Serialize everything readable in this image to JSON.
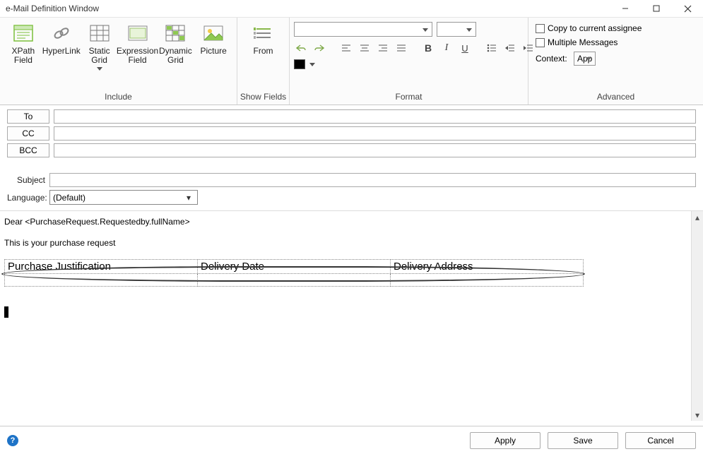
{
  "window": {
    "title": "e-Mail Definition Window"
  },
  "ribbon": {
    "include": {
      "label": "Include",
      "xpath": "XPath\nField",
      "hyperlink": "HyperLink",
      "staticgrid": "Static\nGrid",
      "exprfield": "Expression\nField",
      "dyngrid": "Dynamic\nGrid",
      "picture": "Picture"
    },
    "showfields": {
      "label": "Show Fields",
      "from": "From"
    },
    "format": {
      "label": "Format"
    },
    "advanced": {
      "label": "Advanced",
      "copy": "Copy to current assignee",
      "multi": "Multiple Messages",
      "contextlbl": "Context:",
      "contextval": "App"
    }
  },
  "fields": {
    "to": "To",
    "cc": "CC",
    "bcc": "BCC",
    "subject": "Subject",
    "language": "Language:",
    "language_val": "(Default)"
  },
  "body": {
    "line1": "Dear <PurchaseRequest.Requestedby.fullName>",
    "line2": "This is your purchase request",
    "headers": [
      "Purchase Justification",
      "Delivery Date",
      "Delivery Address"
    ]
  },
  "buttons": {
    "apply": "Apply",
    "save": "Save",
    "cancel": "Cancel"
  }
}
